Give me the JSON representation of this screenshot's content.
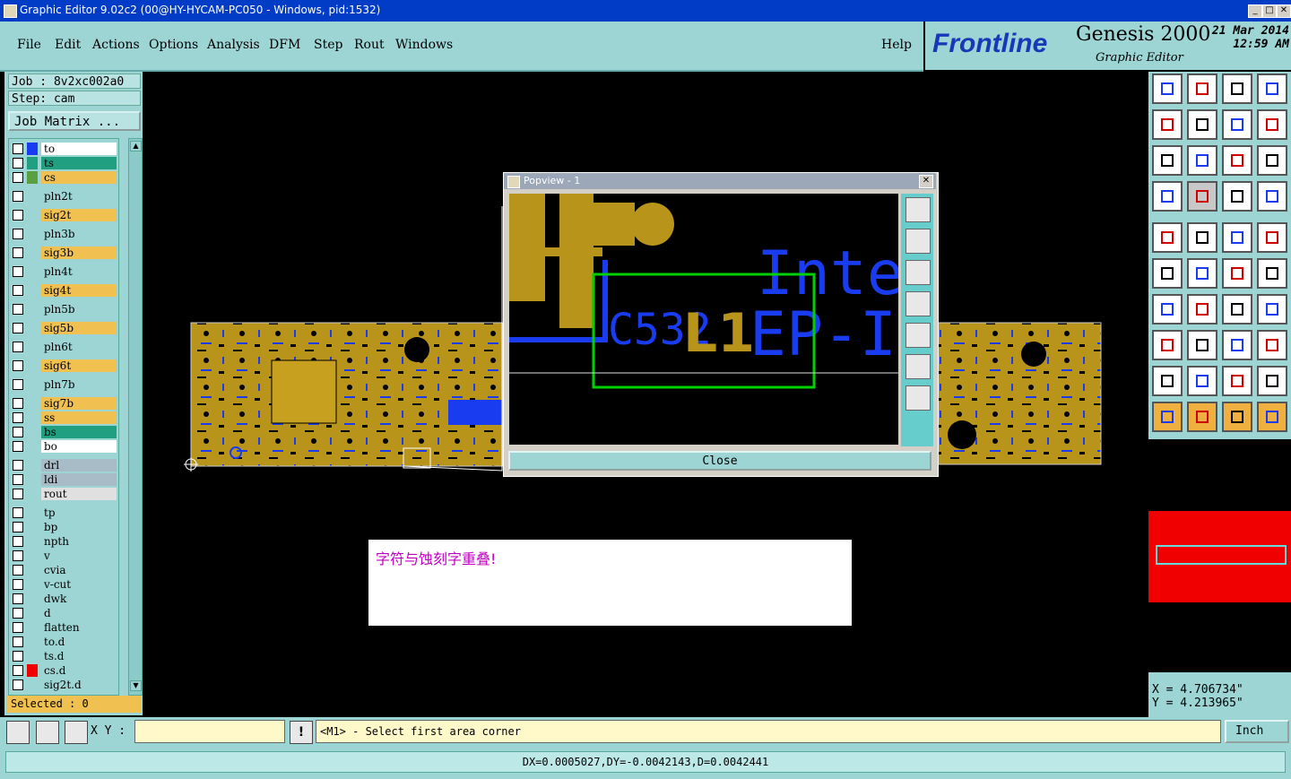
{
  "window": {
    "title": "Graphic Editor 9.02c2 (00@HY-HYCAM-PC050 - Windows, pid:1532)",
    "minimize": "_",
    "maximize": "□",
    "close": "✕"
  },
  "menu": {
    "items": [
      "File",
      "Edit",
      "Actions",
      "Options",
      "Analysis",
      "DFM",
      "Step",
      "Rout",
      "Windows"
    ],
    "help": "Help"
  },
  "branding": {
    "logo": "Frontline",
    "product": "Genesis 2000",
    "subtitle": "Graphic Editor",
    "date": "21 Mar 2014",
    "time": "12:59 AM"
  },
  "job": {
    "job_label": "Job : 8v2xc002a0",
    "step_label": "Step: cam",
    "matrix_button": "Job Matrix ...",
    "selected": "Selected : 0"
  },
  "layers": [
    {
      "name": "to",
      "color": "#ffffff",
      "swatch": "#1a3cf0"
    },
    {
      "name": "ts",
      "color": "#20a080",
      "swatch": "#20a080"
    },
    {
      "name": "cs",
      "color": "#f0c050",
      "swatch": "#5aa040"
    },
    {
      "name": "pln2t",
      "color": "#9dd4d4",
      "swatch": ""
    },
    {
      "name": "sig2t",
      "color": "#f0c050",
      "swatch": ""
    },
    {
      "name": "pln3b",
      "color": "#9dd4d4",
      "swatch": ""
    },
    {
      "name": "sig3b",
      "color": "#f0c050",
      "swatch": ""
    },
    {
      "name": "pln4t",
      "color": "#9dd4d4",
      "swatch": ""
    },
    {
      "name": "sig4t",
      "color": "#f0c050",
      "swatch": ""
    },
    {
      "name": "pln5b",
      "color": "#9dd4d4",
      "swatch": ""
    },
    {
      "name": "sig5b",
      "color": "#f0c050",
      "swatch": ""
    },
    {
      "name": "pln6t",
      "color": "#9dd4d4",
      "swatch": ""
    },
    {
      "name": "sig6t",
      "color": "#f0c050",
      "swatch": ""
    },
    {
      "name": "pln7b",
      "color": "#9dd4d4",
      "swatch": ""
    },
    {
      "name": "sig7b",
      "color": "#f0c050",
      "swatch": ""
    },
    {
      "name": "ss",
      "color": "#f0c050",
      "swatch": ""
    },
    {
      "name": "bs",
      "color": "#20a080",
      "swatch": ""
    },
    {
      "name": "bo",
      "color": "#ffffff",
      "swatch": ""
    },
    {
      "name": "drl",
      "color": "#a8bcc8",
      "swatch": ""
    },
    {
      "name": "ldi",
      "color": "#a8bcc8",
      "swatch": ""
    },
    {
      "name": "rout",
      "color": "#e0e0e0",
      "swatch": ""
    },
    {
      "name": "tp",
      "color": "#9dd4d4",
      "swatch": ""
    },
    {
      "name": "bp",
      "color": "#9dd4d4",
      "swatch": ""
    },
    {
      "name": "npth",
      "color": "#9dd4d4",
      "swatch": ""
    },
    {
      "name": "v",
      "color": "#9dd4d4",
      "swatch": ""
    },
    {
      "name": "cvia",
      "color": "#9dd4d4",
      "swatch": ""
    },
    {
      "name": "v-cut",
      "color": "#9dd4d4",
      "swatch": ""
    },
    {
      "name": "dwk",
      "color": "#9dd4d4",
      "swatch": ""
    },
    {
      "name": "d",
      "color": "#9dd4d4",
      "swatch": ""
    },
    {
      "name": "flatten",
      "color": "#9dd4d4",
      "swatch": ""
    },
    {
      "name": "to.d",
      "color": "#9dd4d4",
      "swatch": ""
    },
    {
      "name": "ts.d",
      "color": "#9dd4d4",
      "swatch": ""
    },
    {
      "name": "cs.d",
      "color": "#9dd4d4",
      "swatch": "#f00000"
    },
    {
      "name": "sig2t.d",
      "color": "#9dd4d4",
      "swatch": ""
    }
  ],
  "popview": {
    "title": "Popview - 1",
    "close_label": "Close",
    "text_c532": "C532",
    "text_l1": "L1",
    "text_ep": "EP-I",
    "text_inte": "Inte"
  },
  "message": "字符与蚀刻字重叠!",
  "bottom": {
    "xy_label": "X Y :",
    "xy_value": "",
    "prompt": "<M1> - Select first area corner",
    "unit": "Inch",
    "measure": "DX=0.0005027,DY=-0.0042143,D=0.0042441"
  },
  "cursor": {
    "x_label": "X = 4.706734\"",
    "y_label": "Y = 4.213965\""
  },
  "tool_icons": [
    "zoom-home-icon",
    "zoom-page-icon",
    "home-icon",
    "window-icon",
    "pan-left-icon",
    "pan-right-icon",
    "undo-zoom-icon",
    "redraw-icon",
    "fit-icon",
    "center-icon",
    "scale-1-2-icon",
    "help-icon",
    "measure-tool-icon",
    "grid-icon",
    "snap-icon",
    "snap-alt-icon",
    "add-pad-icon",
    "edit-shape-icon",
    "ruler-icon",
    "point-icon",
    "connect-icon",
    "cross-icon",
    "line-point-icon",
    "arc-point-icon",
    "draw-line-icon",
    "edit-line-icon",
    "rotate-icon",
    "mirror-icon",
    "move-icon",
    "horizontal-line-icon",
    "resize-icon",
    "group-icon",
    "triangle-icon",
    "triangle-up-icon",
    "triangle-a-icon",
    "triangle-b-icon",
    "select-icon",
    "select-box-icon",
    "select-net-icon",
    "select-path-icon"
  ]
}
